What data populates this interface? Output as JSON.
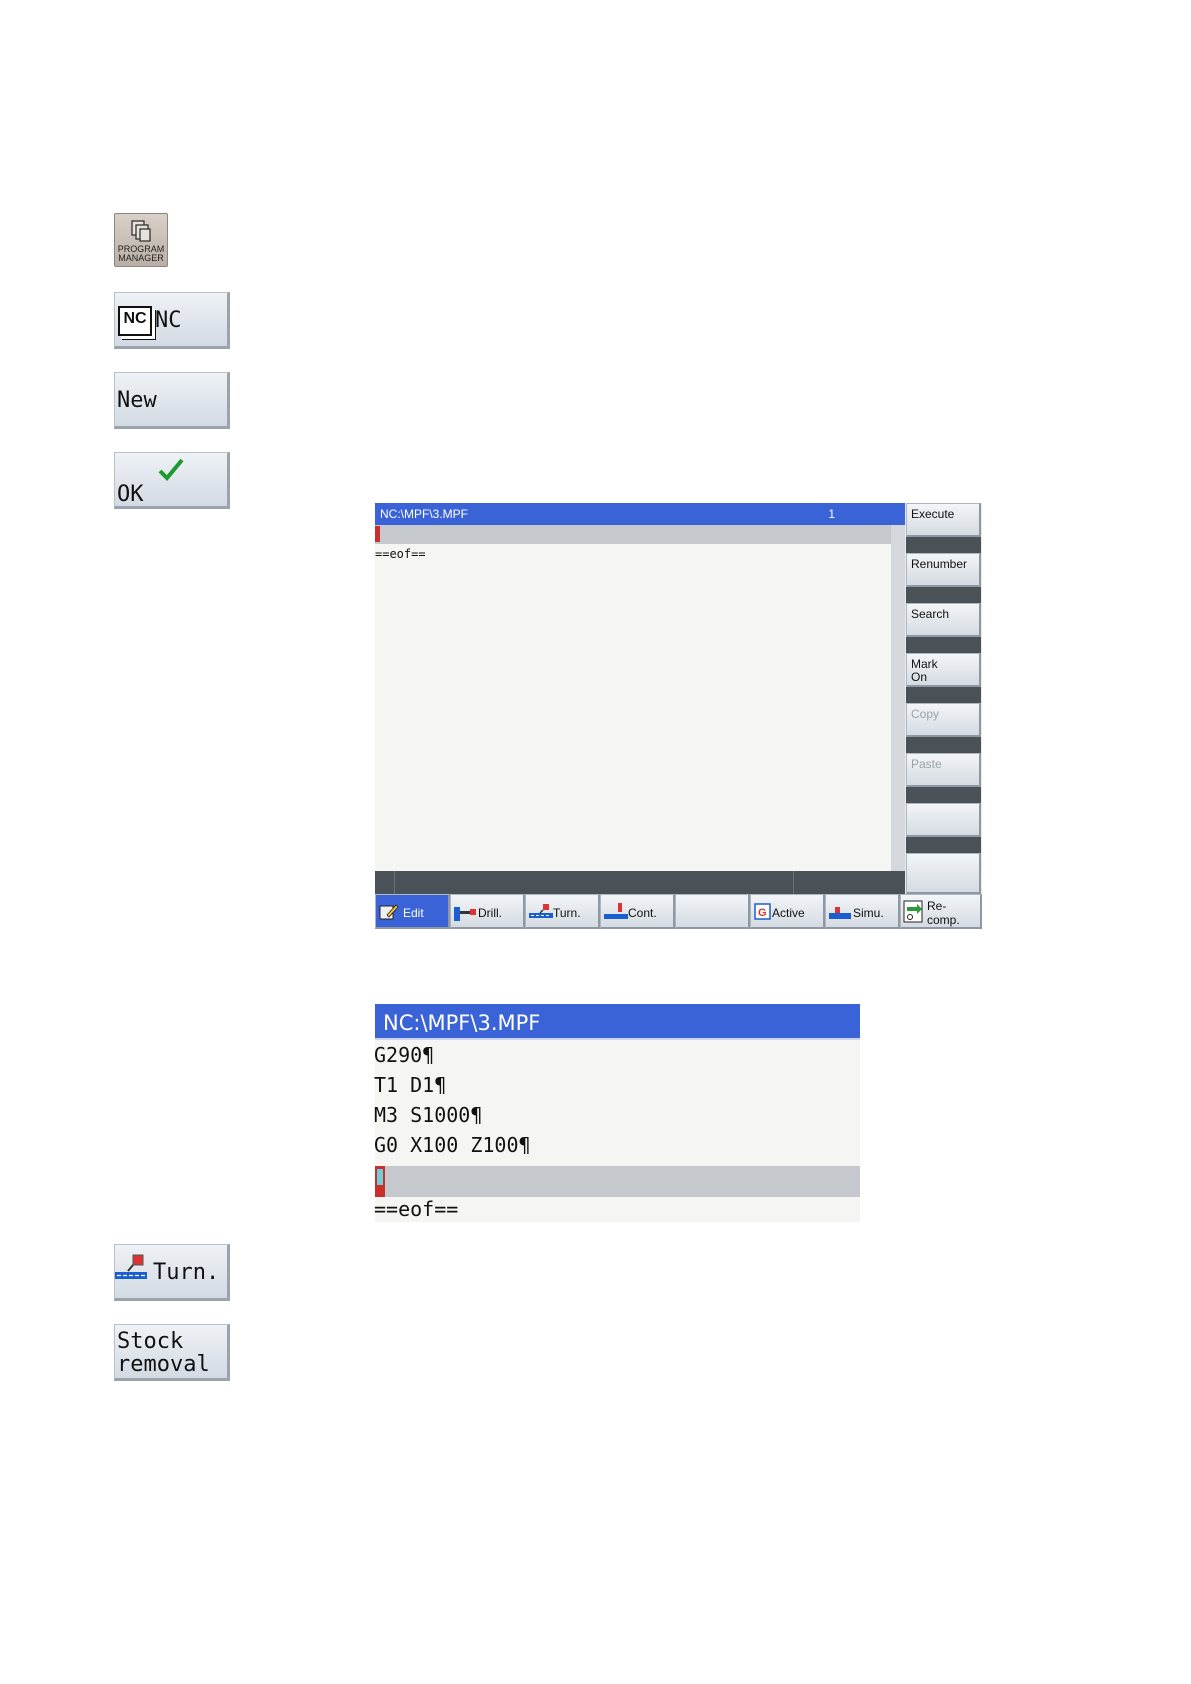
{
  "softkeys_left": {
    "program_manager": "PROGRAM\nMANAGER",
    "nc": "NC",
    "nc_badge": "NC",
    "new": "New",
    "ok": "OK",
    "turn": "Turn.",
    "stock_removal_1": "Stock",
    "stock_removal_2": "removal"
  },
  "editor": {
    "title": "NC:\\MPF\\3.MPF",
    "line_number": "1",
    "eof": "==eof=="
  },
  "vertical_softkeys": [
    {
      "label": "Execute",
      "enabled": true
    },
    {
      "label": "Renumber",
      "enabled": true
    },
    {
      "label": "Search",
      "enabled": true
    },
    {
      "label": "Mark\nOn",
      "enabled": true
    },
    {
      "label": "Copy",
      "enabled": false
    },
    {
      "label": "Paste",
      "enabled": false
    },
    {
      "label": "",
      "enabled": true
    },
    {
      "label": "",
      "enabled": true
    }
  ],
  "horizontal_softkeys": [
    {
      "label": "Edit",
      "icon": "edit-icon",
      "active": true
    },
    {
      "label": "Drill.",
      "icon": "drill-icon"
    },
    {
      "label": "Turn.",
      "icon": "turn-icon"
    },
    {
      "label": "Cont.",
      "icon": "contour-icon"
    },
    {
      "label": "",
      "icon": ""
    },
    {
      "label": "Active",
      "icon": "g-code-icon"
    },
    {
      "label": "Simu.",
      "icon": "simulation-icon"
    },
    {
      "label": "Re-\ncomp.",
      "icon": "recompile-icon"
    }
  ],
  "code_panel": {
    "title": "NC:\\MPF\\3.MPF",
    "lines": [
      "G290¶",
      "T1 D1¶",
      "M3 S1000¶",
      "G0 X100 Z100¶"
    ],
    "eof": "==eof=="
  },
  "colors": {
    "title_bar": "#3a63d8",
    "cursor_red": "#c9302b",
    "status_bar": "#4a5257"
  }
}
